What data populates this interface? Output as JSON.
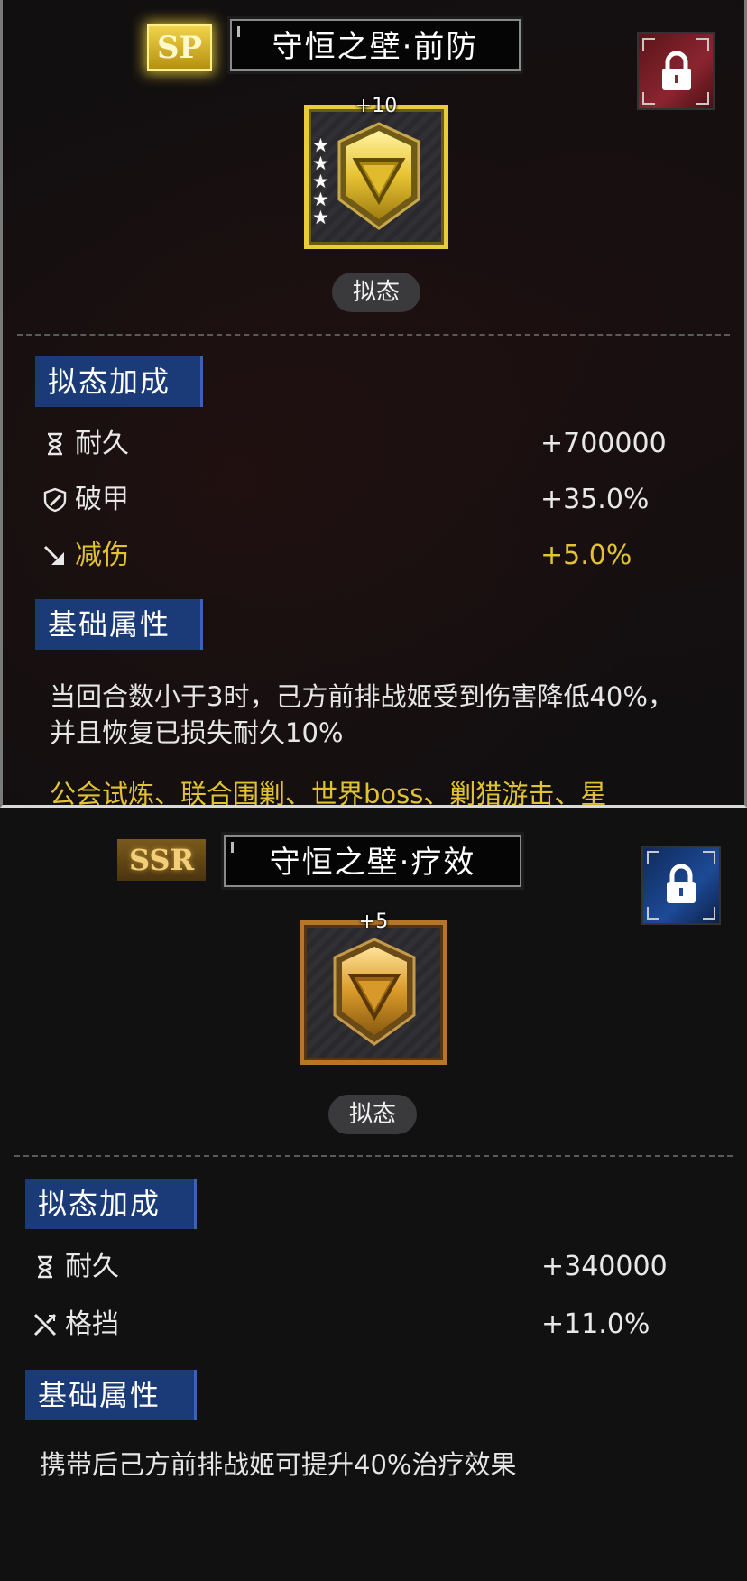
{
  "cards": [
    {
      "rarity": "SP",
      "name": "守恒之壁·前防",
      "level": "+10",
      "stars": 5,
      "mimic_label": "拟态",
      "bonus_title": "拟态加成",
      "stats": [
        {
          "icon": "hourglass-icon",
          "name": "耐久",
          "value": "+700000"
        },
        {
          "icon": "shield-pierce-icon",
          "name": "破甲",
          "value": "+35.0%"
        },
        {
          "icon": "damage-reduce-icon",
          "name": "减伤",
          "value": "+5.0%"
        }
      ],
      "base_title": "基础属性",
      "description": "当回合数小于3时，己方前排战姬受到伤害降低40%，并且恢复已损失耐久10%",
      "source_text": "公会试炼、联合围剿、世界boss、剿猎游击、星",
      "colors": {
        "frame": "#e9cc3a",
        "lock_bg": "#8b2530",
        "highlight": "#e3c232"
      }
    },
    {
      "rarity": "SSR",
      "name": "守恒之壁·疗效",
      "level": "+5",
      "stars": 0,
      "mimic_label": "拟态",
      "bonus_title": "拟态加成",
      "stats": [
        {
          "icon": "hourglass-icon",
          "name": "耐久",
          "value": "+340000"
        },
        {
          "icon": "block-icon",
          "name": "格挡",
          "value": "+11.0%"
        }
      ],
      "base_title": "基础属性",
      "description": "携带后己方前排战姬可提升40%治疗效果",
      "colors": {
        "frame": "#b4762a",
        "lock_bg": "#1d4a96"
      }
    }
  ]
}
